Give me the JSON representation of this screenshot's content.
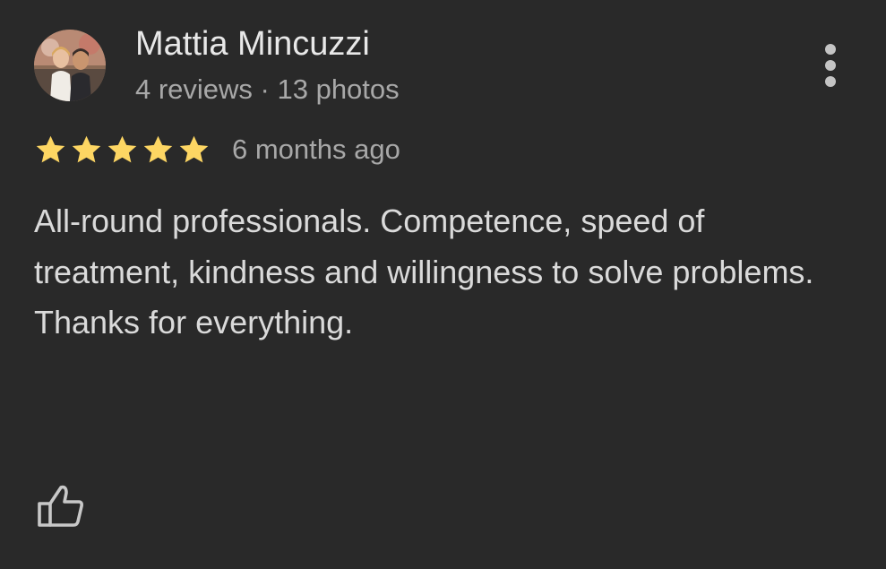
{
  "reviewer": {
    "name": "Mattia Mincuzzi",
    "meta": "4 reviews · 13 photos"
  },
  "review": {
    "rating": 5,
    "max_rating": 5,
    "date": "6 months ago",
    "paragraphs": [
      "All-round professionals. Competence, speed of treatment, kindness and willingness to solve problems.",
      "Thanks for everything."
    ]
  },
  "colors": {
    "background": "#292929",
    "star": "#fdd663",
    "text_primary": "#e8e8e8",
    "text_secondary": "#a8a8a8"
  },
  "icons": {
    "menu": "more-vert-icon",
    "like": "thumb-up-outline-icon",
    "rating": "star-icon"
  }
}
